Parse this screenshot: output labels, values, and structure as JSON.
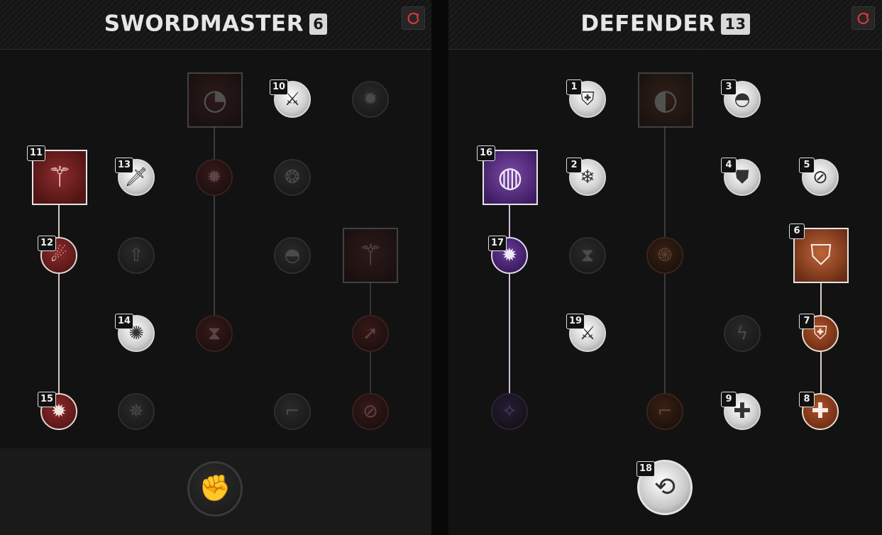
{
  "left": {
    "title": "SWORDMASTER",
    "points": "6",
    "footer_icon": "raised-fist-icon"
  },
  "right": {
    "title": "DEFENDER",
    "points": "13"
  },
  "colors": {
    "reset_icon": "#d9363e",
    "swordmaster_accent": "#8c2a2a",
    "defender_accent_purple": "#6a3c9a",
    "defender_accent_orange": "#b0532a"
  },
  "nodes": {
    "sm_square_top": {
      "icon": "sword-slash-circle-icon",
      "state": "inactive"
    },
    "sm_10": {
      "rank": "10",
      "icon": "sword-impact-icon",
      "state": "active"
    },
    "sm_top_right": {
      "icon": "upgrade-burst-icon",
      "state": "inactive"
    },
    "sm_11": {
      "rank": "11",
      "icon": "lunging-swordsman-icon",
      "state": "active"
    },
    "sm_13": {
      "rank": "13",
      "icon": "sword-icon",
      "state": "active"
    },
    "sm_mid_upgrade": {
      "icon": "upgrade-burst-icon",
      "state": "inactive"
    },
    "sm_whirl": {
      "icon": "whirlwind-icon",
      "state": "inactive"
    },
    "sm_12": {
      "rank": "12",
      "icon": "dash-figure-icon",
      "state": "active"
    },
    "sm_boot_up": {
      "icon": "boot-upgrade-icon",
      "state": "inactive"
    },
    "sm_helmet": {
      "icon": "helmet-icon",
      "state": "inactive"
    },
    "sm_square_right": {
      "icon": "leaping-warrior-icon",
      "state": "inactive"
    },
    "sm_14": {
      "rank": "14",
      "icon": "burst-orb-icon",
      "state": "active"
    },
    "sm_hourglass": {
      "icon": "hourglass-down-icon",
      "state": "inactive"
    },
    "sm_arrow": {
      "icon": "arrow-up-right-icon",
      "state": "inactive"
    },
    "sm_15": {
      "rank": "15",
      "icon": "upgrade-burst-icon",
      "state": "active"
    },
    "sm_gear": {
      "icon": "gear-burst-icon",
      "state": "inactive"
    },
    "sm_boot": {
      "icon": "boot-icon",
      "state": "inactive"
    },
    "sm_boot_no": {
      "icon": "boot-blocked-icon",
      "state": "inactive"
    },
    "df_1": {
      "rank": "1",
      "icon": "armor-vest-icon",
      "state": "active"
    },
    "df_square_top": {
      "icon": "rolling-shield-icon",
      "state": "inactive"
    },
    "df_3": {
      "rank": "3",
      "icon": "helmet-icon",
      "state": "active"
    },
    "df_16": {
      "rank": "16",
      "icon": "shield-bash-icon",
      "state": "active"
    },
    "df_2": {
      "rank": "2",
      "icon": "frost-sword-icon",
      "state": "active"
    },
    "df_4": {
      "rank": "4",
      "icon": "shield-face-icon",
      "state": "active"
    },
    "df_5": {
      "rank": "5",
      "icon": "broken-shield-icon",
      "state": "active"
    },
    "df_6": {
      "rank": "6",
      "icon": "kite-shield-icon",
      "state": "active"
    },
    "df_17": {
      "rank": "17",
      "icon": "upgrade-burst-icon",
      "state": "active"
    },
    "df_hourglass": {
      "icon": "hourglass-icon",
      "state": "inactive"
    },
    "df_spiral": {
      "icon": "spiral-icon",
      "state": "inactive"
    },
    "df_19": {
      "rank": "19",
      "icon": "sword-impact-icon",
      "state": "active"
    },
    "df_lightning": {
      "icon": "lightning-icon",
      "state": "inactive"
    },
    "df_7": {
      "rank": "7",
      "icon": "shield-guard-icon",
      "state": "active"
    },
    "df_orbit": {
      "icon": "orbit-stars-icon",
      "state": "inactive"
    },
    "df_boot": {
      "icon": "boot-icon",
      "state": "inactive"
    },
    "df_9": {
      "rank": "9",
      "icon": "plus-heal-icon",
      "state": "active"
    },
    "df_8": {
      "rank": "8",
      "icon": "cross-heal-icon",
      "state": "active"
    },
    "df_18": {
      "rank": "18",
      "icon": "shield-rotate-icon",
      "state": "active"
    }
  }
}
